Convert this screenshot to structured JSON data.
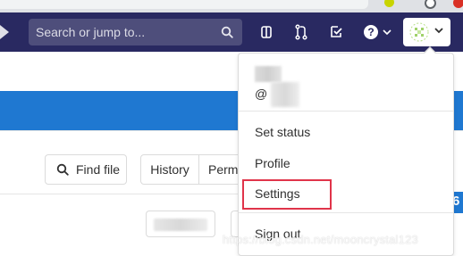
{
  "navbar": {
    "search_placeholder": "Search or jump to...",
    "icons": [
      "search-icon",
      "issues-icon",
      "merge-request-icon",
      "todos-icon",
      "help-icon",
      "avatar-icon"
    ]
  },
  "toolbar": {
    "find_file": "Find file",
    "history": "History",
    "permalink_partial": "Perma"
  },
  "user_menu": {
    "username_prefix": "@",
    "items": [
      "Set status",
      "Profile",
      "Settings",
      "Sign out"
    ],
    "highlighted": "Settings"
  },
  "watermark": "https://blog.csdn.net/mooncrystal123",
  "colors": {
    "navbar": "#292961",
    "search": "#4e4e7b",
    "banner": "#1f78d1",
    "highlight": "#e0344a"
  }
}
